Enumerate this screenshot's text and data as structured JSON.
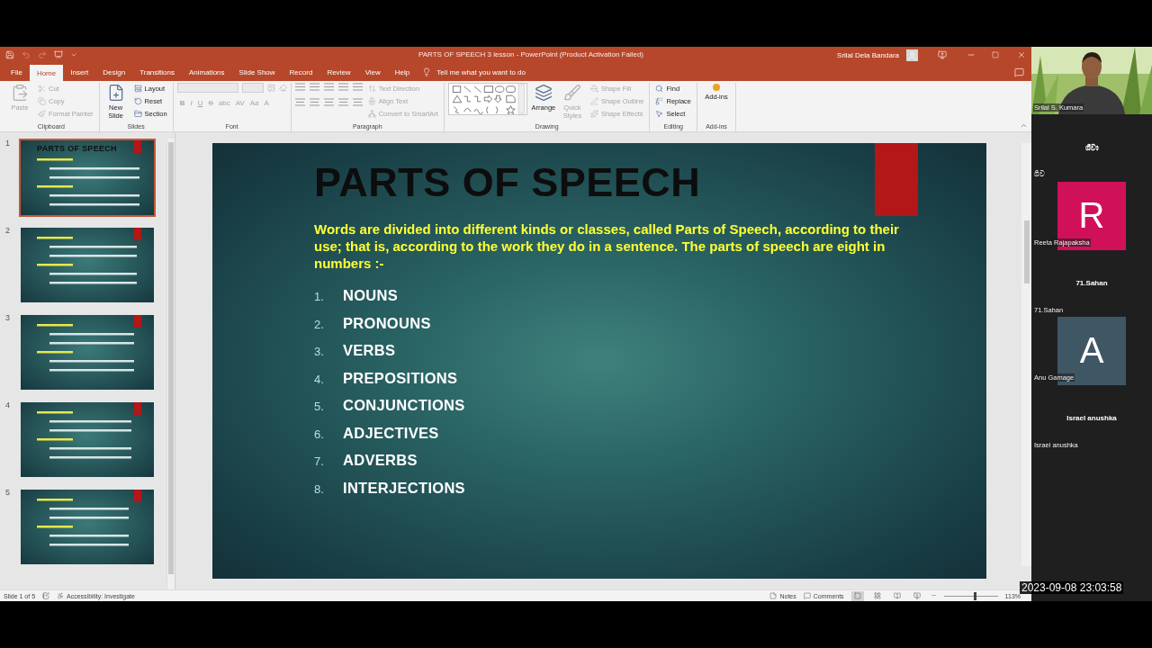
{
  "window": {
    "title": "PARTS OF SPEECH 3 lesson  -  PowerPoint (Product Activation Failed)",
    "user": "Srilal Dela Bandara"
  },
  "tabs": [
    {
      "label": "File",
      "selected": false
    },
    {
      "label": "Home",
      "selected": true
    },
    {
      "label": "Insert",
      "selected": false
    },
    {
      "label": "Design",
      "selected": false
    },
    {
      "label": "Transitions",
      "selected": false
    },
    {
      "label": "Animations",
      "selected": false
    },
    {
      "label": "Slide Show",
      "selected": false
    },
    {
      "label": "Record",
      "selected": false
    },
    {
      "label": "Review",
      "selected": false
    },
    {
      "label": "View",
      "selected": false
    },
    {
      "label": "Help",
      "selected": false
    }
  ],
  "tell_me": {
    "placeholder": "Tell me what you want to do"
  },
  "ribbon": {
    "groups": [
      {
        "label": "Clipboard",
        "commands": [
          {
            "kind": "large",
            "label": "Paste",
            "disabled": true
          },
          {
            "kind": "small",
            "label": "Cut",
            "disabled": true
          },
          {
            "kind": "small",
            "label": "Copy",
            "disabled": true
          },
          {
            "kind": "small",
            "label": "Format Painter",
            "disabled": true
          }
        ]
      },
      {
        "label": "Slides",
        "commands": [
          {
            "kind": "large",
            "label": "New Slide",
            "disabled": false
          },
          {
            "kind": "small",
            "label": "Layout",
            "disabled": false
          },
          {
            "kind": "small",
            "label": "Reset",
            "disabled": false
          },
          {
            "kind": "small",
            "label": "Section",
            "disabled": false
          }
        ]
      },
      {
        "label": "Font",
        "commands": [
          {
            "kind": "field",
            "disabled": true
          },
          {
            "kind": "field",
            "disabled": true
          },
          {
            "kind": "glyph",
            "label": "B",
            "disabled": true
          },
          {
            "kind": "glyph",
            "label": "I",
            "disabled": true
          },
          {
            "kind": "glyph",
            "label": "U",
            "disabled": true
          },
          {
            "kind": "glyph",
            "label": "S",
            "disabled": true
          },
          {
            "kind": "glyph",
            "label": "abc",
            "disabled": true
          },
          {
            "kind": "glyph",
            "label": "AV",
            "disabled": true
          },
          {
            "kind": "glyph",
            "label": "Aa",
            "disabled": true
          },
          {
            "kind": "glyph",
            "label": "A",
            "disabled": true
          }
        ]
      },
      {
        "label": "Paragraph",
        "commands": [
          {
            "kind": "small",
            "label": "Text Direction",
            "disabled": true
          },
          {
            "kind": "small",
            "label": "Align Text",
            "disabled": true
          },
          {
            "kind": "small",
            "label": "Convert to SmartArt",
            "disabled": true
          }
        ]
      },
      {
        "label": "Drawing",
        "commands": [
          {
            "kind": "large",
            "label": "Arrange",
            "disabled": false
          },
          {
            "kind": "large",
            "label": "Quick Styles",
            "disabled": true
          },
          {
            "kind": "small",
            "label": "Shape Fill",
            "disabled": true
          },
          {
            "kind": "small",
            "label": "Shape Outline",
            "disabled": true
          },
          {
            "kind": "small",
            "label": "Shape Effects",
            "disabled": true
          }
        ]
      },
      {
        "label": "Editing",
        "commands": [
          {
            "kind": "small",
            "label": "Find",
            "disabled": false
          },
          {
            "kind": "small",
            "label": "Replace",
            "disabled": false
          },
          {
            "kind": "small",
            "label": "Select",
            "disabled": false
          }
        ]
      },
      {
        "label": "Add-ins",
        "commands": [
          {
            "kind": "large",
            "label": "Add-ins",
            "disabled": false
          }
        ]
      }
    ]
  },
  "thumbnails": [
    {
      "number": "1",
      "selected": true,
      "title": "PARTS OF SPEECH"
    },
    {
      "number": "2",
      "selected": false
    },
    {
      "number": "3",
      "selected": false
    },
    {
      "number": "4",
      "selected": false
    },
    {
      "number": "5",
      "selected": false
    }
  ],
  "slide": {
    "title": "PARTS OF SPEECH",
    "intro": "Words are divided into different kinds or classes, called Parts of Speech, according to their use; that is, according to the work they do in a sentence. The parts of speech are eight in numbers :-",
    "items": [
      {
        "number": "1.",
        "label": "NOUNS"
      },
      {
        "number": "2.",
        "label": "PRONOUNS"
      },
      {
        "number": "3.",
        "label": "VERBS"
      },
      {
        "number": "4.",
        "label": "PREPOSITIONS"
      },
      {
        "number": "5.",
        "label": "CONJUNCTIONS"
      },
      {
        "number": "6.",
        "label": "ADJECTIVES"
      },
      {
        "number": "7.",
        "label": "ADVERBS"
      },
      {
        "number": "8.",
        "label": "INTERJECTIONS"
      }
    ]
  },
  "status_bar": {
    "slide": "Slide 1 of 5",
    "accessibility": "Accessibility: Investigate",
    "notes": "Notes",
    "comments": "Comments",
    "views": [
      {
        "selected": true
      },
      {
        "selected": false
      },
      {
        "selected": false
      },
      {
        "selected": false
      }
    ],
    "zoom_slider": {
      "level": 0.55
    },
    "zoom": "113%"
  },
  "participants": [
    {
      "kind": "video",
      "label": "Srilal S. Kumara"
    },
    {
      "kind": "name",
      "name": "ශීවා",
      "label": "ශීව"
    },
    {
      "kind": "avatar",
      "initial": "R",
      "color": "#d1105a",
      "label": "Reeta Rajapaksha"
    },
    {
      "kind": "name",
      "name": "71.Sahan",
      "label": "71.Sahan"
    },
    {
      "kind": "avatar",
      "initial": "A",
      "color": "#3f5665",
      "label": "Anu  Gamage"
    },
    {
      "kind": "name",
      "name": "Israel anushka",
      "label": "Israel anushka"
    }
  ],
  "timestamp": "2023-09-08 23:03:58"
}
